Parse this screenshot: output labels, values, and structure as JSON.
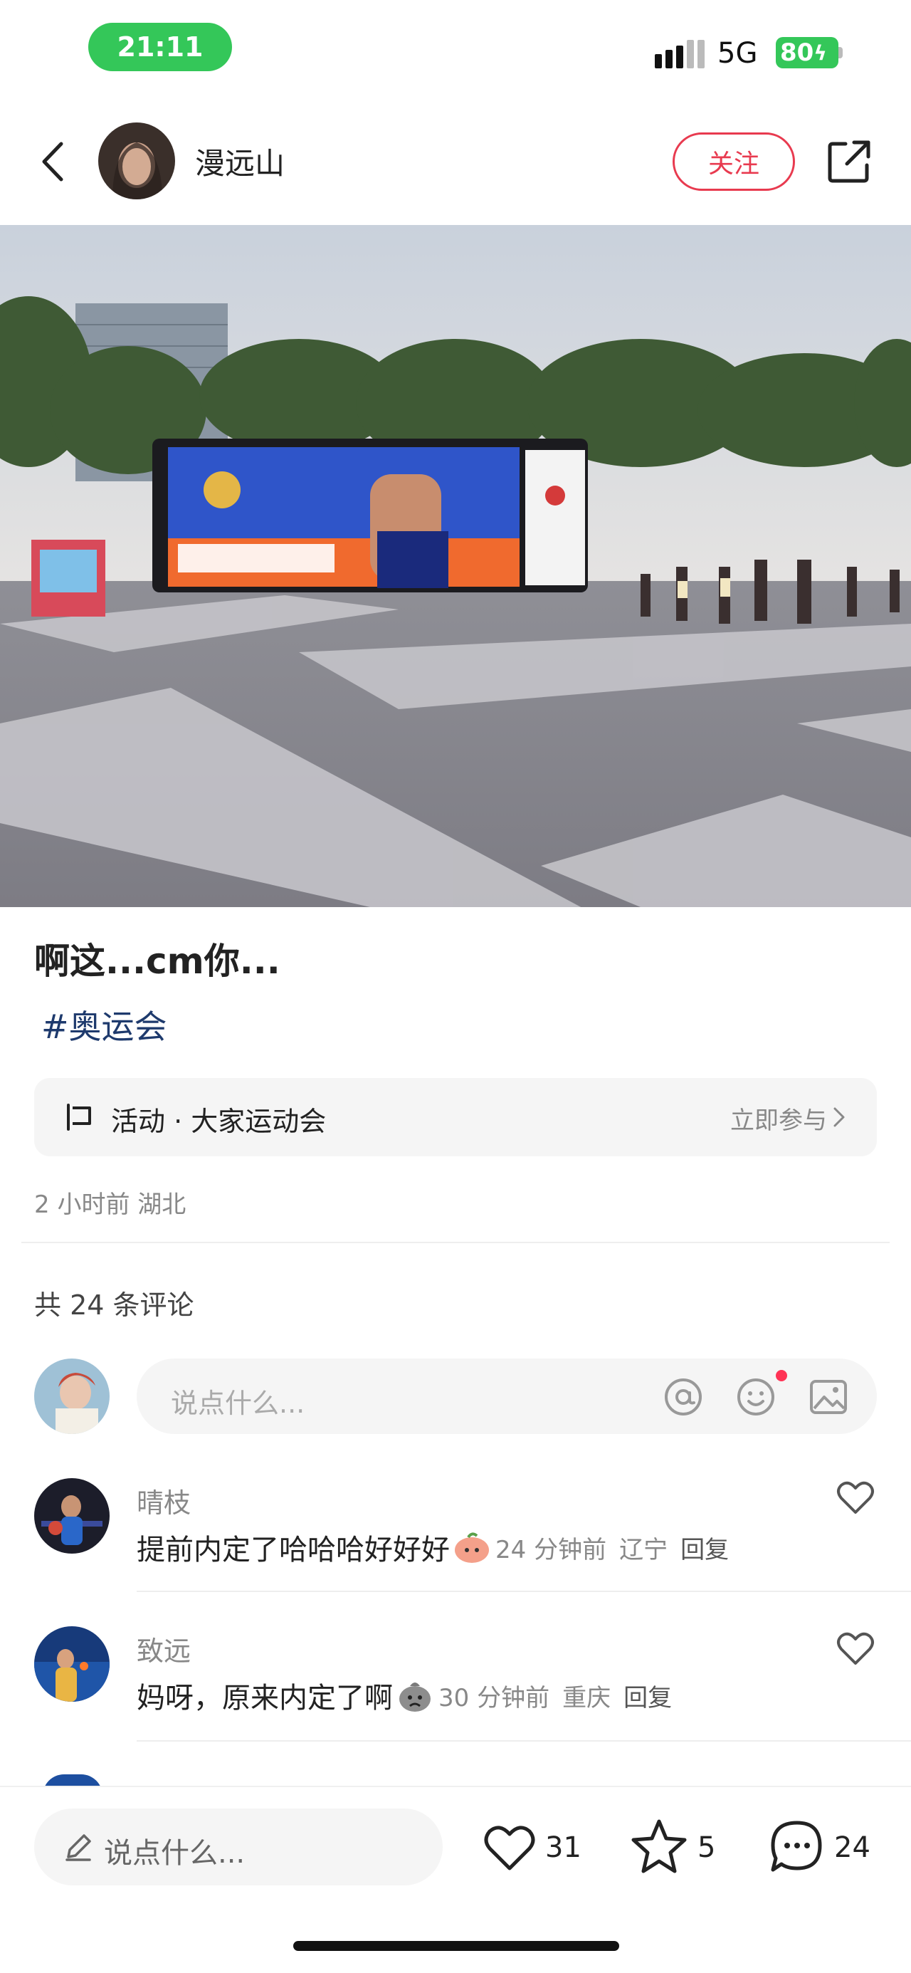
{
  "status_bar": {
    "time": "21:11",
    "network": "5G",
    "battery": "80"
  },
  "header": {
    "author": "漫远山",
    "follow_label": "关注"
  },
  "post": {
    "title": "啊这...cm你...",
    "hashtag": "#奥运会",
    "activity_label": "活动 · 大家运动会",
    "activity_cta": "立即参与",
    "meta": "2 小时前  湖北"
  },
  "comments": {
    "count_label": "共 24 条评论",
    "input_placeholder": "说点什么...",
    "items": [
      {
        "name": "晴枝",
        "text": "提前内定了哈哈哈好好好",
        "time": "24 分钟前",
        "location": "辽宁",
        "reply": "回复"
      },
      {
        "name": "致远",
        "text": "妈呀，原来内定了啊",
        "time": "30 分钟前",
        "location": "重庆",
        "reply": "回复"
      }
    ]
  },
  "bottom_bar": {
    "placeholder": "说点什么...",
    "likes": "31",
    "stars": "5",
    "comments": "24"
  },
  "colors": {
    "accent": "#e83a4f",
    "hashtag": "#1e3a6d",
    "status_green": "#34c759"
  }
}
